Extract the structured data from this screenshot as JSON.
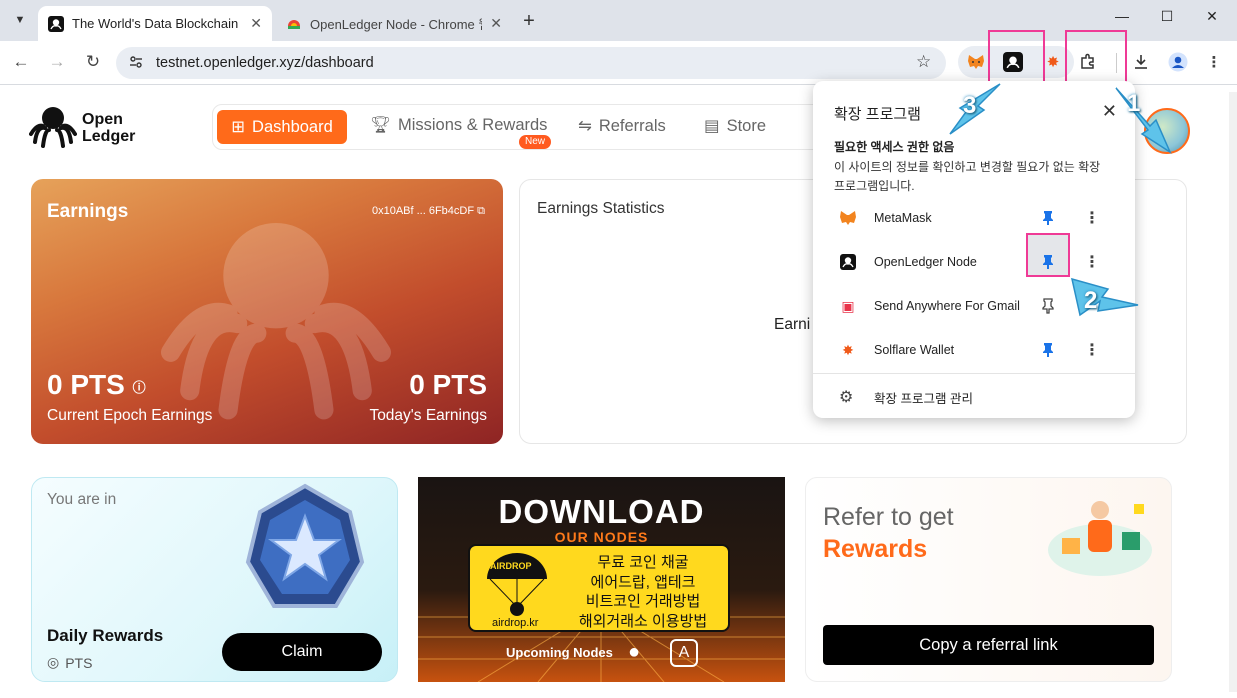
{
  "browser": {
    "tabs": [
      {
        "title": "The World's Data Blockchain fo"
      },
      {
        "title": "OpenLedger Node - Chrome 웹"
      }
    ],
    "url": "testnet.openledger.xyz/dashboard"
  },
  "site": {
    "logo": {
      "line1": "Open",
      "line2": "Ledger"
    },
    "nav": [
      {
        "label": "Dashboard"
      },
      {
        "label": "Missions & Rewards"
      },
      {
        "label": "Referrals"
      },
      {
        "label": "Store"
      }
    ],
    "new_badge": "New"
  },
  "earnings": {
    "title": "Earnings",
    "address": "0x10ABf ... 6Fb4cDF",
    "current_value": "0 PTS",
    "current_label": "Current Epoch Earnings",
    "today_value": "0 PTS",
    "today_label": "Today's Earnings"
  },
  "stats": {
    "title": "Earnings Statistics",
    "center_text": "Earni"
  },
  "daily": {
    "status_text": "You are in",
    "title": "Daily Rewards",
    "pts_label": "PTS",
    "claim_label": "Claim"
  },
  "download": {
    "title": "DOWNLOAD",
    "subtitle": "OUR NODES",
    "airdrop_label": "AIRDROP",
    "airdrop_site": "airdrop.kr",
    "promo_lines": [
      "무료 코인 채굴",
      "에어드랍, 앱테크",
      "비트코인 거래방법",
      "해외거래소 이용방법"
    ],
    "upcoming": "Upcoming Nodes"
  },
  "referral": {
    "line1": "Refer to get",
    "line2": "Rewards",
    "button": "Copy a referral link"
  },
  "extensions_popup": {
    "title": "확장 프로그램",
    "notice_title": "필요한 액세스 권한 없음",
    "notice_body": "이 사이트의 정보를 확인하고 변경할 필요가 없는 확장 프로그램입니다.",
    "items": [
      {
        "name": "MetaMask",
        "pinned": true
      },
      {
        "name": "OpenLedger Node",
        "pinned": true
      },
      {
        "name": "Send Anywhere For Gmail",
        "pinned": false
      },
      {
        "name": "Solflare Wallet",
        "pinned": true
      }
    ],
    "manage": "확장 프로그램 관리"
  },
  "annotations": [
    "1",
    "2",
    "3"
  ],
  "colors": {
    "accent": "#ff6a1a",
    "highlight": "#ef3a96",
    "pin": "#1a73e8"
  }
}
